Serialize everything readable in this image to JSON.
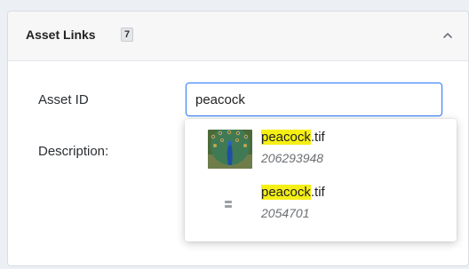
{
  "panel": {
    "title": "Asset Links",
    "count": "7"
  },
  "form": {
    "asset_id_label": "Asset ID",
    "asset_id_value": "peacock",
    "description_label": "Description:"
  },
  "results": [
    {
      "highlight": "peacock",
      "rest": ".tif",
      "id": "206293948",
      "thumbnail": "peacock-image"
    },
    {
      "highlight": "peacock",
      "rest": ".tif",
      "id": "2054701",
      "thumbnail": "file-icon"
    }
  ],
  "colors": {
    "accent": "#3b82f6",
    "highlight": "#f6ef16"
  }
}
